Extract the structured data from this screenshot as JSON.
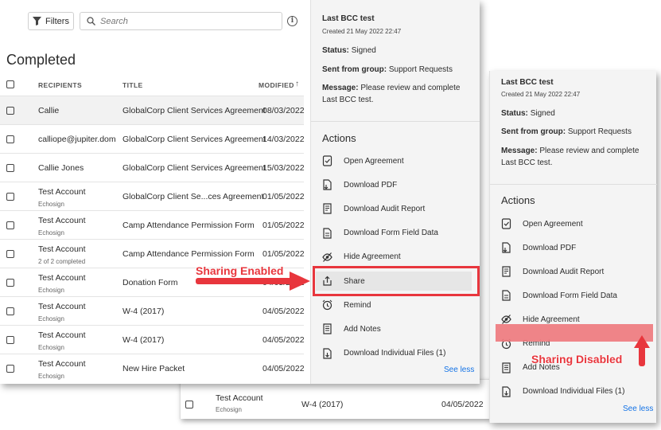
{
  "toolbar": {
    "filters_label": "Filters",
    "search_placeholder": "Search",
    "info_glyph": "i"
  },
  "page_title": "Completed",
  "columns": {
    "recipients": "RECIPIENTS",
    "title": "TITLE",
    "modified": "MODIFIED",
    "sort_glyph": "↑"
  },
  "rows": [
    {
      "recipient": "Callie",
      "sub": "",
      "title": "GlobalCorp Client Services Agreement",
      "modified": "08/03/2022",
      "selected": true
    },
    {
      "recipient": "calliope@jupiter.dom",
      "sub": "",
      "title": "GlobalCorp Client Services Agreement",
      "modified": "14/03/2022"
    },
    {
      "recipient": "Callie Jones",
      "sub": "",
      "title": "GlobalCorp Client Services Agreement",
      "modified": "15/03/2022"
    },
    {
      "recipient": "Test Account",
      "sub": "Echosign",
      "title": "GlobalCorp Client Se...ces Agreement",
      "modified": "01/05/2022"
    },
    {
      "recipient": "Test Account",
      "sub": "Echosign",
      "title": "Camp Attendance Permission Form",
      "modified": "01/05/2022"
    },
    {
      "recipient": "Test Account",
      "sub": "2 of 2 completed",
      "title": "Camp Attendance Permission Form",
      "modified": "01/05/2022"
    },
    {
      "recipient": "Test Account",
      "sub": "Echosign",
      "title": "Donation Form",
      "modified": "04/05/2022"
    },
    {
      "recipient": "Test Account",
      "sub": "Echosign",
      "title": "W-4 (2017)",
      "modified": "04/05/2022"
    },
    {
      "recipient": "Test Account",
      "sub": "Echosign",
      "title": "W-4 (2017)",
      "modified": "04/05/2022"
    },
    {
      "recipient": "Test Account",
      "sub": "Echosign",
      "title": "New Hire Packet",
      "modified": "04/05/2022"
    }
  ],
  "back_row": {
    "recipient": "Test Account",
    "sub": "Echosign",
    "title": "W-4 (2017)",
    "modified": "04/05/2022"
  },
  "detail": {
    "title": "Last BCC test",
    "created": "Created 21 May 2022 22:47",
    "status_label": "Status:",
    "status_value": "Signed",
    "group_label": "Sent from group:",
    "group_value": "Support Requests",
    "message_label": "Message:",
    "message_value": "Please review and complete Last BCC test.",
    "actions_heading": "Actions",
    "actions_enabled": [
      "Open Agreement",
      "Download PDF",
      "Download Audit Report",
      "Download Form Field Data",
      "Hide Agreement",
      "Share",
      "Remind",
      "Add Notes",
      "Download Individual Files (1)"
    ],
    "actions_disabled": [
      "Open Agreement",
      "Download PDF",
      "Download Audit Report",
      "Download Form Field Data",
      "Hide Agreement",
      "Remind",
      "Add Notes",
      "Download Individual Files (1)"
    ],
    "see_less": "See less"
  },
  "annotations": {
    "enabled": "Sharing Enabled",
    "disabled": "Sharing Disabled"
  },
  "colors": {
    "highlight": "#e8363d",
    "link": "#1473e6"
  },
  "icons": [
    "filter-icon",
    "search-icon",
    "info-icon",
    "open-agreement-icon",
    "download-pdf-icon",
    "audit-report-icon",
    "form-data-icon",
    "hide-icon",
    "share-icon",
    "remind-icon",
    "notes-icon",
    "files-icon"
  ]
}
